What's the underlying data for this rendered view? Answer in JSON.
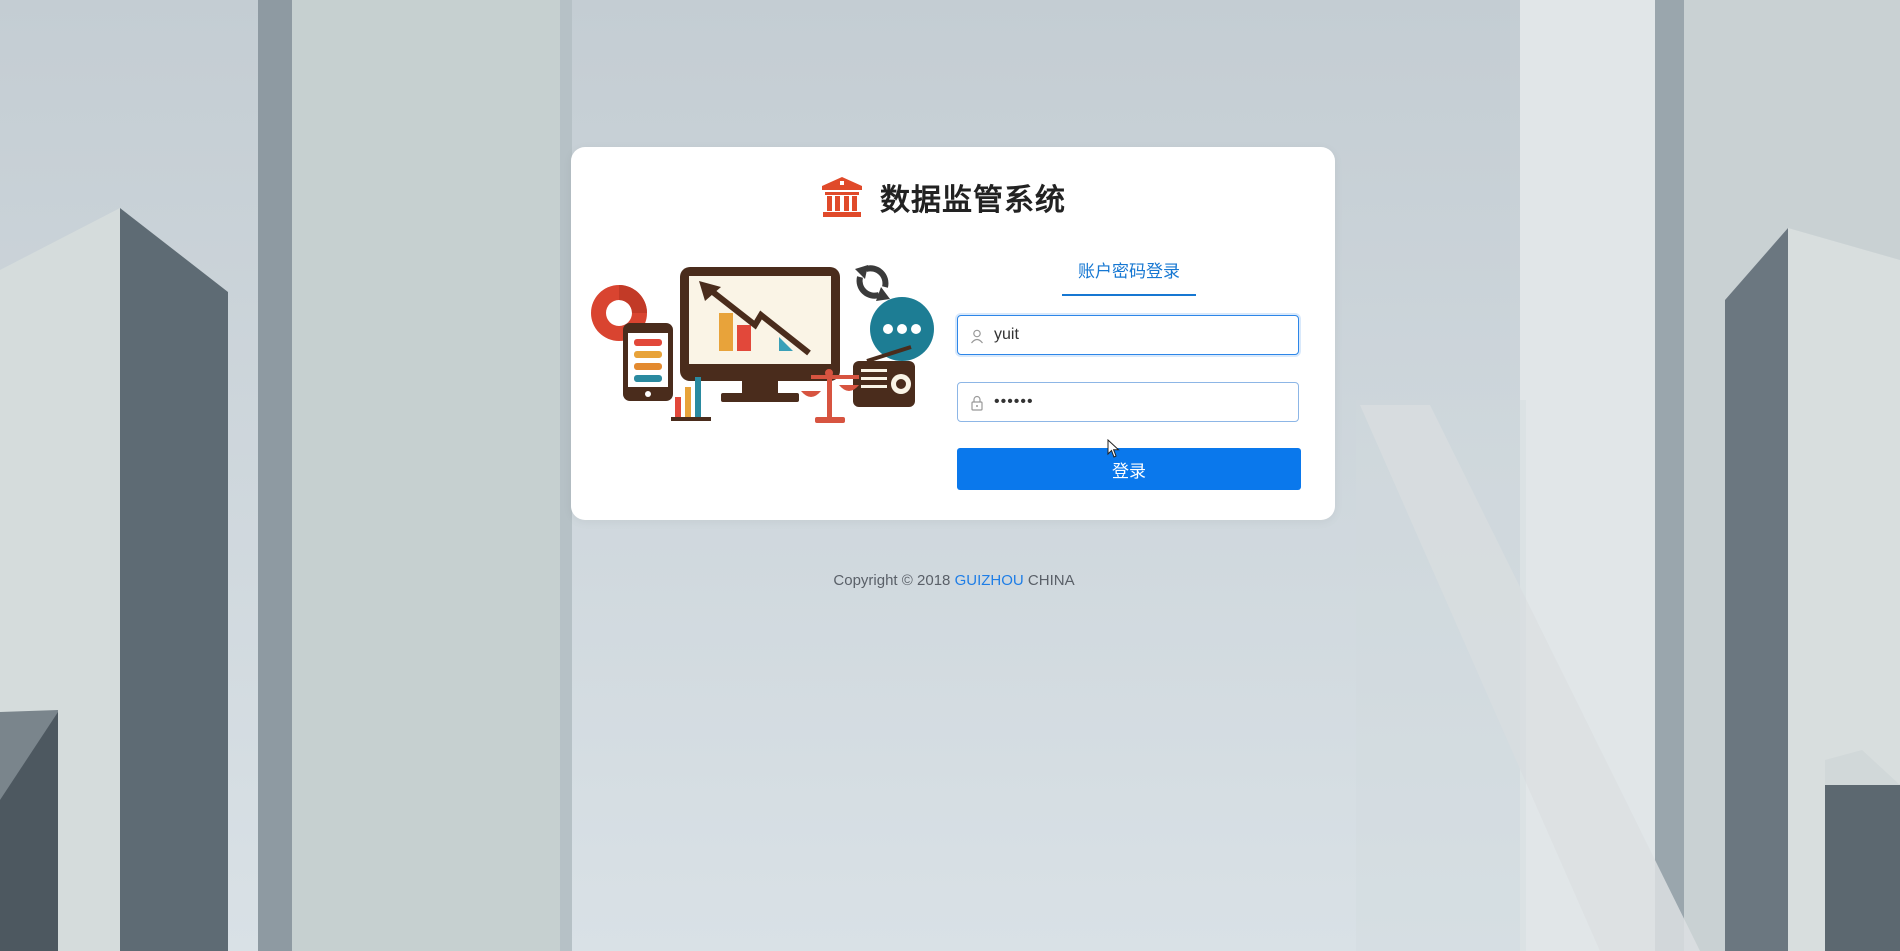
{
  "brand": {
    "title": "数据监管系统",
    "icon": "bank-building-icon",
    "icon_color": "#e04a2a"
  },
  "login": {
    "tab_label": "账户密码登录",
    "username": {
      "value": "yuit",
      "placeholder": "",
      "icon": "user-icon"
    },
    "password": {
      "value": "••••••",
      "placeholder": "",
      "icon": "lock-icon"
    },
    "submit_label": "登录"
  },
  "footer": {
    "copyright": "Copyright",
    "symbol": "©",
    "year": "2018",
    "org": "GUIZHOU",
    "country": "CHINA"
  },
  "illustration": {
    "icons": [
      "pie-chart-icon",
      "smartphone-icon",
      "monitor-chart-icon",
      "refresh-icon",
      "chat-badge-icon",
      "scales-icon",
      "radio-icon",
      "bar-chart-icon"
    ]
  },
  "colors": {
    "accent": "#0a78ec",
    "tab_active": "#1677d2",
    "card": "#ffffff",
    "footer_link": "#1f7ee6"
  }
}
